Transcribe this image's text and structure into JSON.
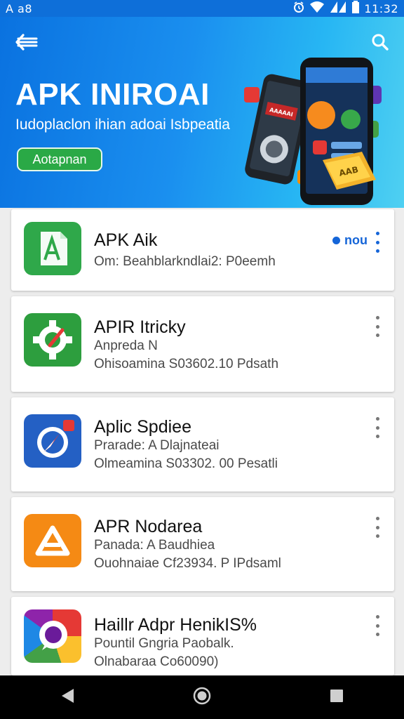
{
  "status_bar": {
    "left_text": "A a8",
    "time": "11:32",
    "icons": [
      "alarm-icon",
      "wifi-icon",
      "signal-icon",
      "battery-icon"
    ]
  },
  "banner": {
    "title": "APK INIROAI",
    "subtitle": "Iudoplaclon ihian adoai Isbpeatia",
    "cta_label": "Aotapnan",
    "phone_screen_label": "AAAAAI",
    "box_label": "AAB"
  },
  "apps": [
    {
      "name": "APK Aik",
      "line1": "Om: Beahblarkndlai2: P0eemh",
      "badge": "nou",
      "icon": "green-document-app-icon",
      "icon_color": "#2fa84a"
    },
    {
      "name": "APIR Itricky",
      "line1": "Anpreda N",
      "line2": "Ohisoamina S03602.10 Pdsath",
      "icon": "green-gear-app-icon",
      "icon_color": "#2d9e3e"
    },
    {
      "name": "Aplic Spdiee",
      "line1": "Prarade: A Dlajnateai",
      "line2": "Olmeamina S03302. 00 Pesatli",
      "icon": "blue-compass-app-icon",
      "icon_color": "#2460c4"
    },
    {
      "name": "APR Nodarea",
      "line1": "Panada: A Baudhiea",
      "line2": "Ouohnaiae Cf23934. P IPdsaml",
      "icon": "orange-triangle-app-icon",
      "icon_color": "#f58a14"
    },
    {
      "name": "Haillr Adpr HenikIS%",
      "line1": "Pountil Gngria Paobalk.",
      "line2": "Olnabaraa Co60090)",
      "icon": "multicolor-chat-app-icon",
      "icon_color": "#e53935"
    }
  ],
  "nav": {
    "icons": [
      "back-triangle-icon",
      "home-circle-icon",
      "recents-square-icon"
    ]
  }
}
